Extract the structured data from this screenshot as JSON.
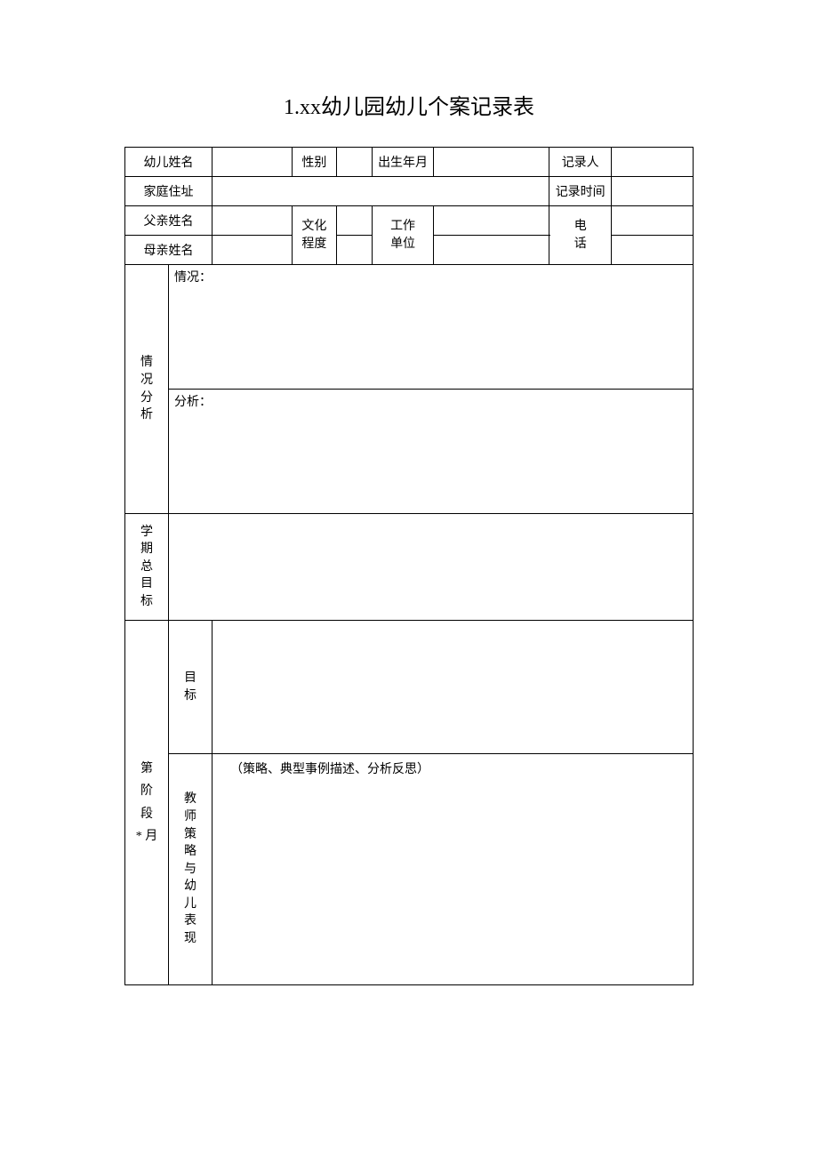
{
  "title": "1.xx幼儿园幼儿个案记录表",
  "labels": {
    "child_name": "幼儿姓名",
    "gender": "性别",
    "birth_date": "出生年月",
    "recorder": "记录人",
    "address": "家庭住址",
    "record_time": "记录时间",
    "father_name": "父亲姓名",
    "mother_name": "母亲姓名",
    "education_l1": "文化",
    "education_l2": "程度",
    "work_l1": "工作",
    "work_l2": "单位",
    "phone_l1": "电",
    "phone_l2": "话"
  },
  "sections": {
    "analysis": {
      "v1": "情",
      "v2": "况",
      "v3": "分",
      "v4": "析",
      "situation": "情况：",
      "analysis_text": "分析："
    },
    "semester_goal": {
      "v1": "学",
      "v2": "期",
      "v3": "总",
      "v4": "目",
      "v5": "标"
    },
    "stage": {
      "v1": "第",
      "v2": "",
      "v3": "阶",
      "v4": "段",
      "v5": "* 月",
      "goal_l1": "目",
      "goal_l2": "标",
      "teacher_v1": "教",
      "teacher_v2": "师",
      "teacher_v3": "策",
      "teacher_v4": "略",
      "teacher_v5": "与",
      "teacher_v6": "幼",
      "teacher_v7": "儿",
      "teacher_v8": "表",
      "teacher_v9": "现",
      "strategy_note": "（策略、典型事例描述、分析反思）"
    }
  },
  "values": {
    "child_name": "",
    "gender": "",
    "birth_date": "",
    "recorder": "",
    "address": "",
    "record_time": "",
    "father_name": "",
    "mother_name": "",
    "father_education": "",
    "mother_education": "",
    "father_work": "",
    "mother_work": "",
    "father_phone": "",
    "mother_phone": ""
  }
}
